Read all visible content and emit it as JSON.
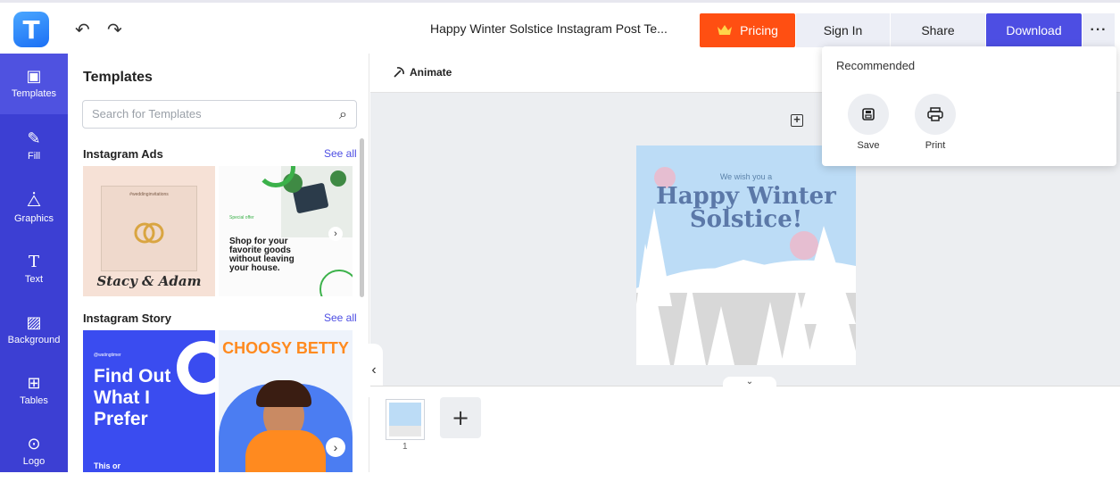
{
  "app": {
    "logo_letter": "T",
    "undo_icon": "undo-icon",
    "redo_icon": "redo-icon"
  },
  "header": {
    "doc_title": "Happy Winter Solstice Instagram Post Te...",
    "pricing_label": "Pricing",
    "signin_label": "Sign In",
    "share_label": "Share",
    "download_label": "Download",
    "more_label": "···",
    "colors": {
      "pricing": "#ff4f12",
      "download": "#4d4ee3",
      "nav": "#3c3fd3"
    }
  },
  "leftnav": {
    "items": [
      {
        "label": "Templates",
        "icon": "templates-icon"
      },
      {
        "label": "Fill",
        "icon": "brush-icon"
      },
      {
        "label": "Graphics",
        "icon": "shapes-icon"
      },
      {
        "label": "Text",
        "icon": "text-icon"
      },
      {
        "label": "Background",
        "icon": "background-icon"
      },
      {
        "label": "Tables",
        "icon": "table-icon"
      },
      {
        "label": "Logo",
        "icon": "logo-icon"
      }
    ]
  },
  "templates": {
    "title": "Templates",
    "search_placeholder": "Search for Templates",
    "sections": [
      {
        "title": "Instagram Ads",
        "see_all": "See all"
      },
      {
        "title": "Instagram Story",
        "see_all": "See all"
      }
    ],
    "ads": {
      "wedding_top": "#weddinginvitations",
      "wedding_names": "Stacy & Adam",
      "shop_small": "Special offer",
      "shop_text": "Shop for your favorite goods without leaving your house."
    },
    "stories": {
      "handle": "@watingtimer",
      "headline": "Find Out What I Prefer",
      "sub": "This or",
      "choosy": "CHOOSY BETTY"
    }
  },
  "workspace": {
    "animate_label": "Animate",
    "design_small": "We wish you a",
    "design_title": "Happy Winter Solstice!",
    "page_number": "1",
    "add_page": "+",
    "toggle": "⌄"
  },
  "dropdown": {
    "title": "Recommended",
    "items": [
      {
        "label": "Save",
        "icon": "save-icon"
      },
      {
        "label": "Print",
        "icon": "print-icon"
      }
    ]
  }
}
